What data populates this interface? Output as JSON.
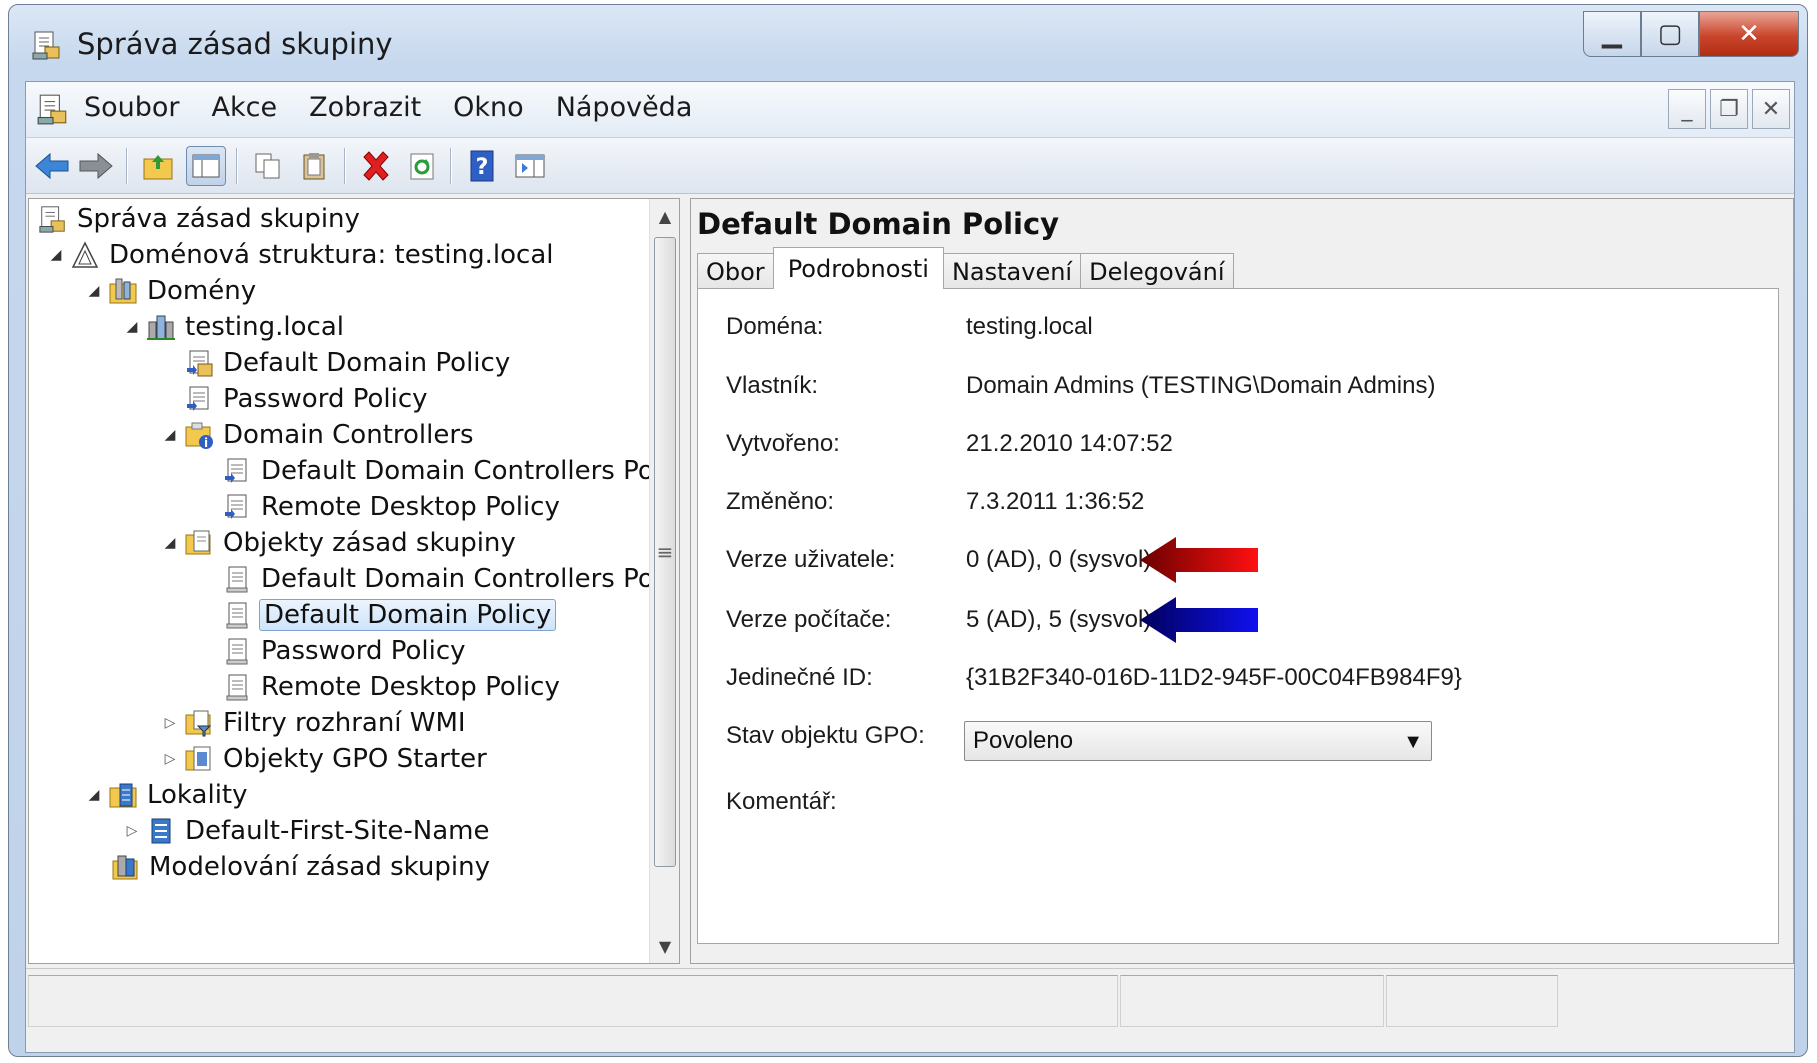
{
  "window": {
    "title": "Správa zásad skupiny"
  },
  "menu": {
    "items": [
      "Soubor",
      "Akce",
      "Zobrazit",
      "Okno",
      "Nápověda"
    ]
  },
  "toolbar": {
    "buttons": [
      "back-arrow",
      "forward-arrow",
      "up-folder",
      "show-hide-console-tree",
      "copy",
      "paste",
      "delete",
      "refresh",
      "help",
      "show-action-pane"
    ]
  },
  "tree": {
    "root": "Správa zásad skupiny",
    "forest": "Doménová struktura: testing.local",
    "domains": "Domény",
    "domain": "testing.local",
    "link_default": "Default Domain Policy",
    "link_password": "Password Policy",
    "dc_ou": "Domain Controllers",
    "dc_default": "Default Domain Controllers Policy",
    "dc_rdp": "Remote Desktop Policy",
    "gpo_container": "Objekty zásad skupiny",
    "gpo_dcpolicy": "Default Domain Controllers Policy",
    "gpo_default": "Default Domain Policy",
    "gpo_password": "Password Policy",
    "gpo_rdp": "Remote Desktop Policy",
    "wmi": "Filtry rozhraní WMI",
    "starter": "Objekty GPO Starter",
    "sites": "Lokality",
    "site": "Default-First-Site-Name",
    "modeling": "Modelování zásad skupiny"
  },
  "details": {
    "title": "Default Domain Policy",
    "tabs": [
      "Obor",
      "Podrobnosti",
      "Nastavení",
      "Delegování"
    ],
    "active_tab": "Podrobnosti",
    "fields": {
      "domain_label": "Doména:",
      "domain_value": "testing.local",
      "owner_label": "Vlastník:",
      "owner_value": "Domain Admins (TESTING\\Domain Admins)",
      "created_label": "Vytvořeno:",
      "created_value": "21.2.2010 14:07:52",
      "modified_label": "Změněno:",
      "modified_value": "7.3.2011 1:36:52",
      "user_ver_label": "Verze uživatele:",
      "user_ver_value": "0 (AD), 0 (sysvol)",
      "comp_ver_label": "Verze počítače:",
      "comp_ver_value": "5 (AD), 5 (sysvol)",
      "uid_label": "Jedinečné ID:",
      "uid_value": "{31B2F340-016D-11D2-945F-00C04FB984F9}",
      "status_label": "Stav objektu GPO:",
      "status_value": "Povoleno",
      "comment_label": "Komentář:"
    }
  },
  "colors": {
    "arrow_user": "#c00000",
    "arrow_computer": "#0000c0"
  }
}
